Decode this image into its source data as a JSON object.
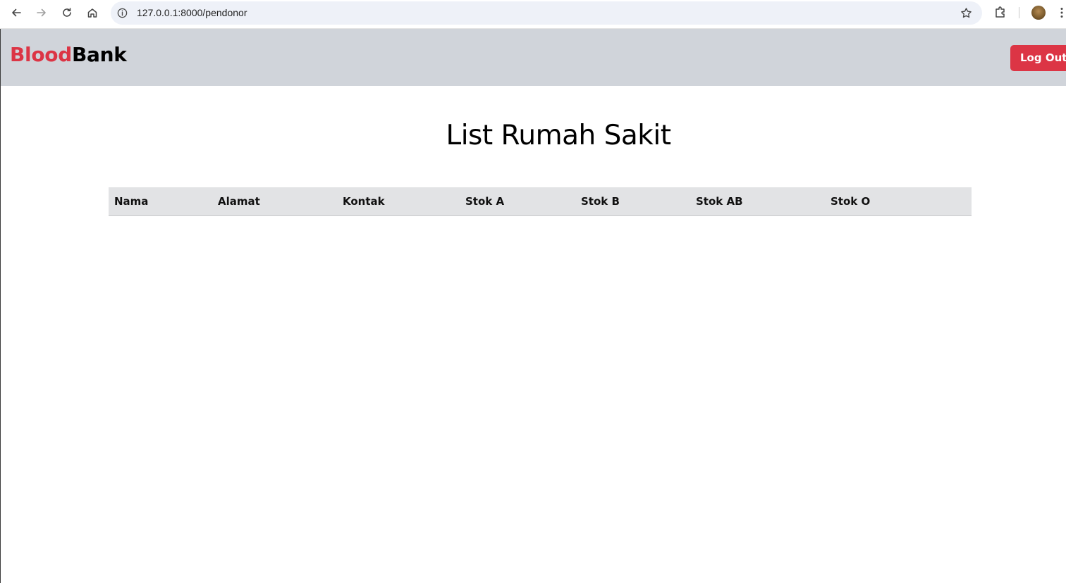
{
  "browser": {
    "url": "127.0.0.1:8000/pendonor"
  },
  "navbar": {
    "brand_first": "Blood",
    "brand_second": "Bank",
    "logout_label": "Log Out"
  },
  "main": {
    "title": "List Rumah Sakit",
    "table": {
      "columns": [
        "Nama",
        "Alamat",
        "Kontak",
        "Stok A",
        "Stok B",
        "Stok AB",
        "Stok O"
      ],
      "rows": []
    }
  },
  "colors": {
    "brand_red": "#dc3545",
    "navbar_bg": "#d0d4da",
    "table_header_bg": "#e2e3e5"
  },
  "icons": [
    "back-arrow-icon",
    "forward-arrow-icon",
    "reload-icon",
    "home-icon",
    "info-icon",
    "star-icon",
    "extensions-icon",
    "kebab-menu-icon"
  ]
}
